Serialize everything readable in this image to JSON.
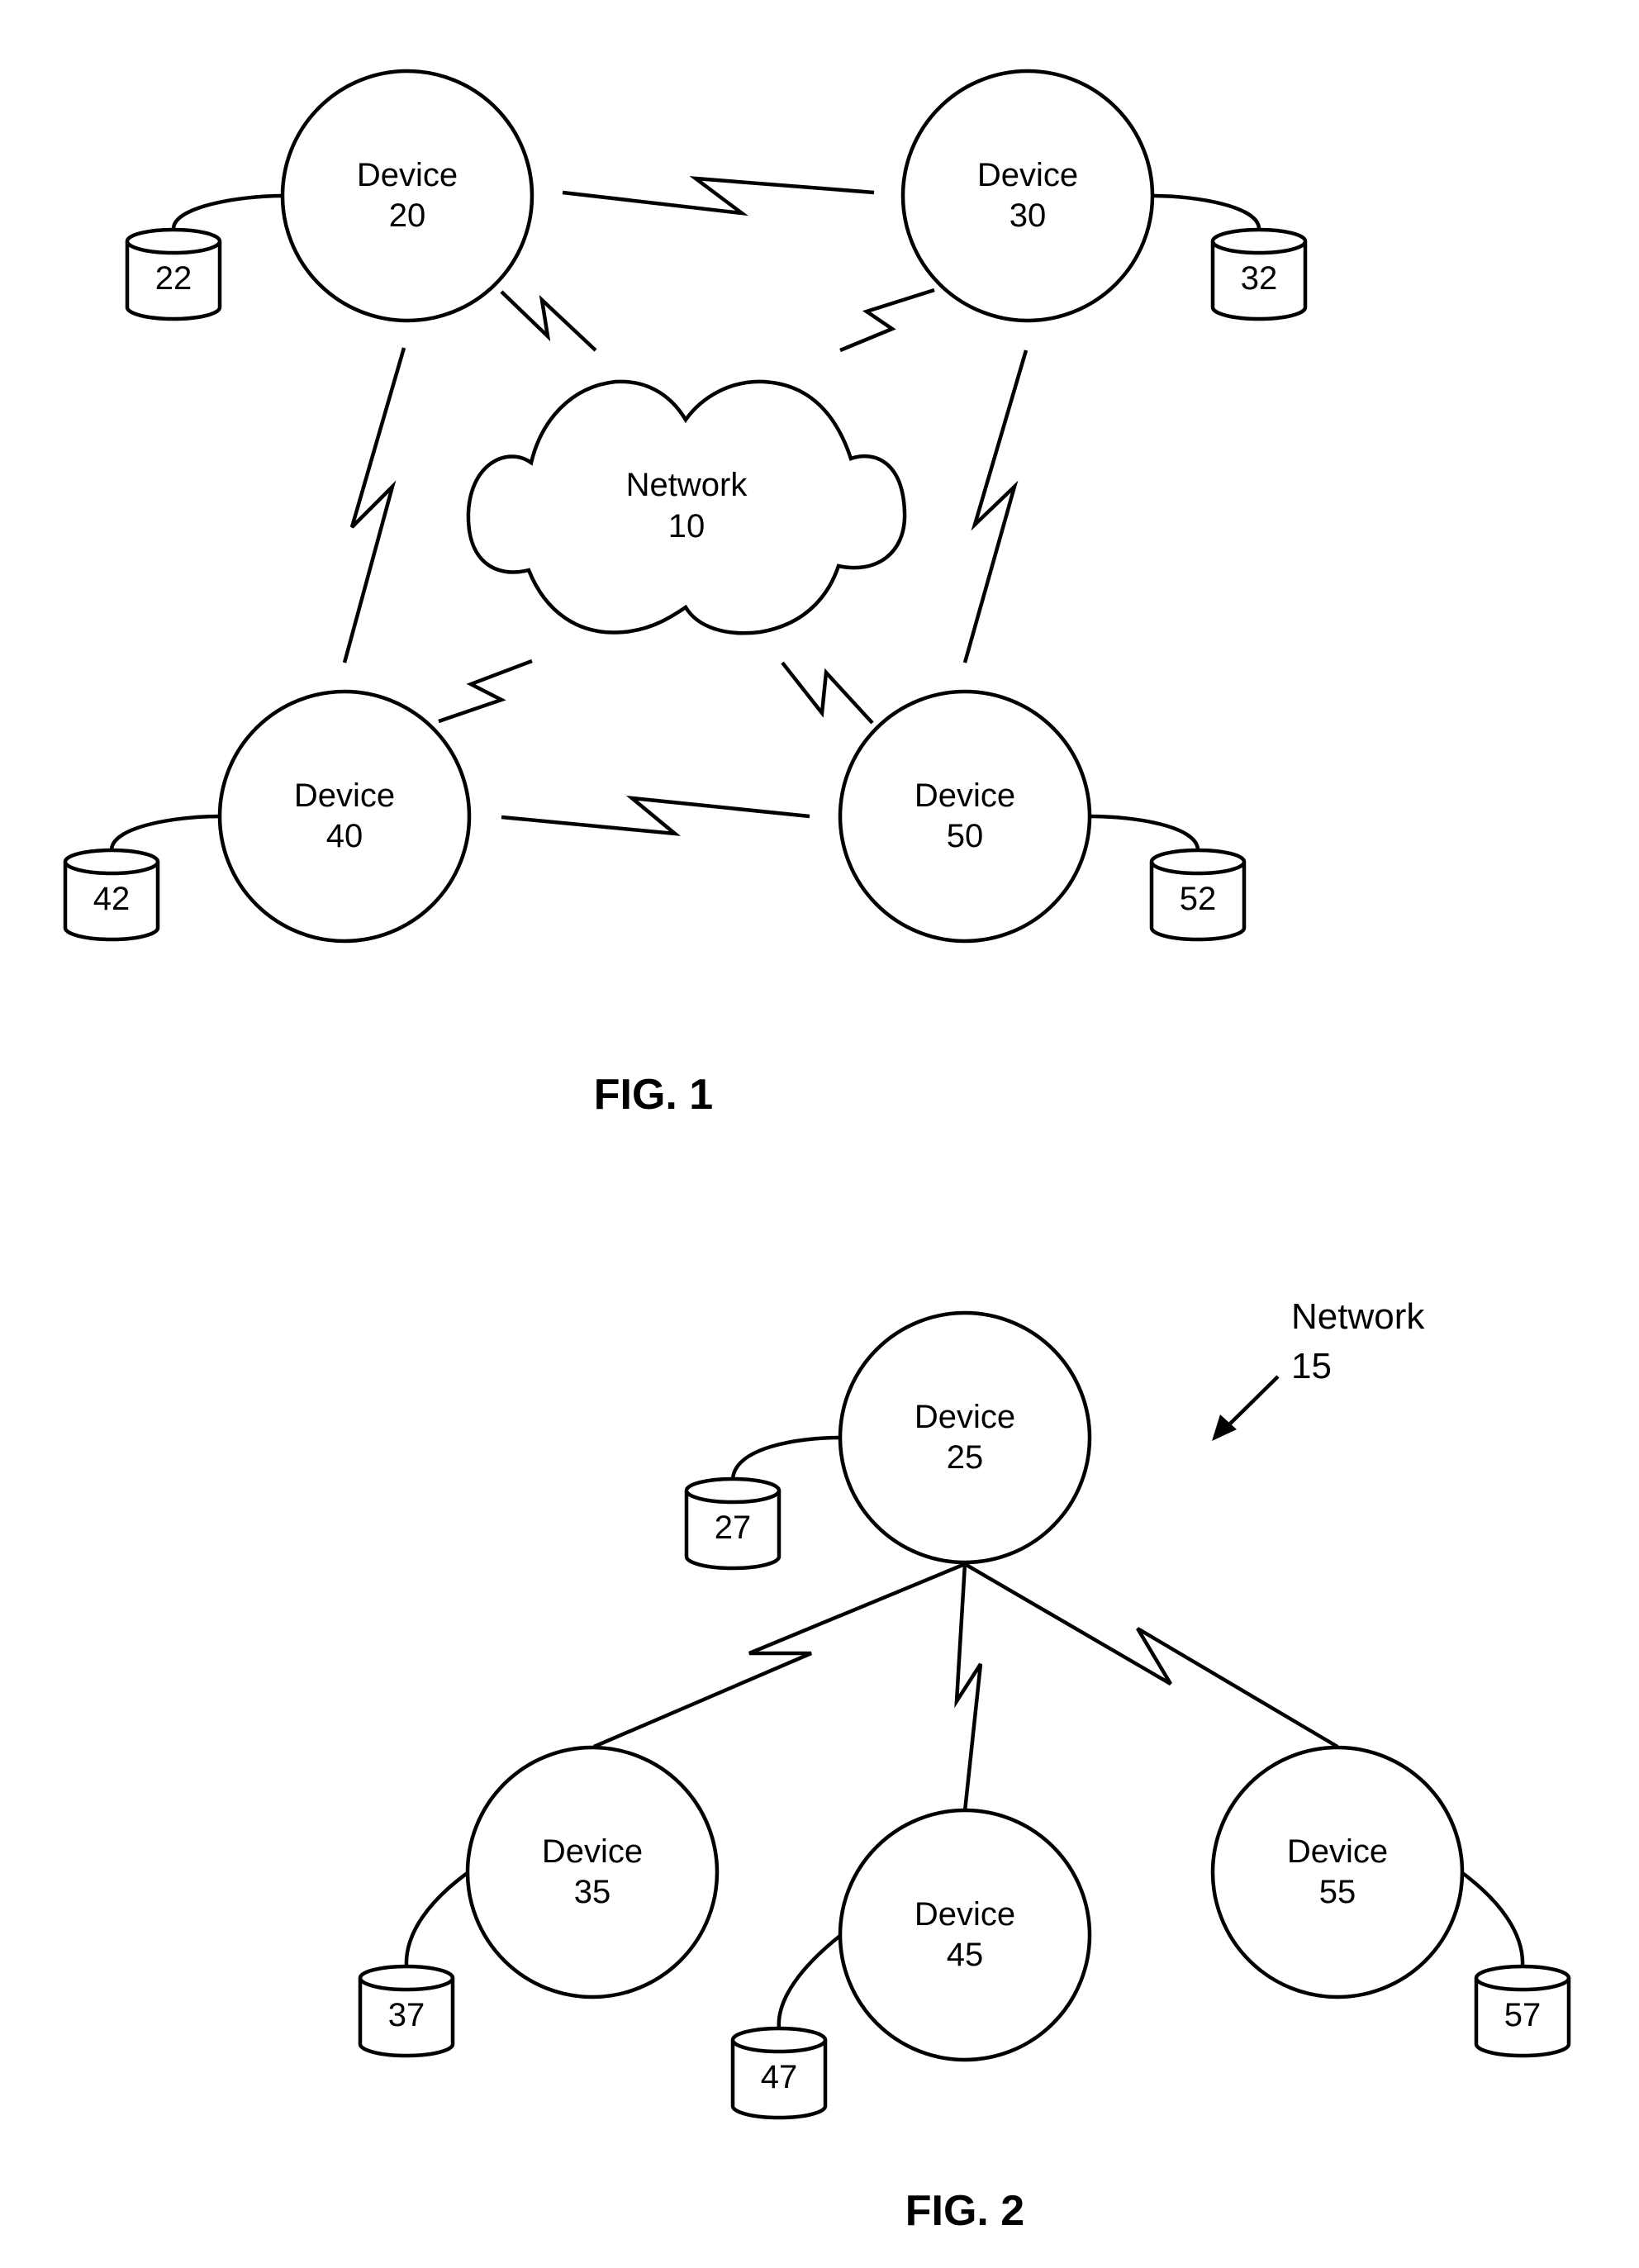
{
  "fig1": {
    "caption": "FIG. 1",
    "network": {
      "label": "Network",
      "number": "10"
    },
    "devices": [
      {
        "id": "20",
        "label": "Device",
        "number": "20",
        "storage": "22"
      },
      {
        "id": "30",
        "label": "Device",
        "number": "30",
        "storage": "32"
      },
      {
        "id": "40",
        "label": "Device",
        "number": "40",
        "storage": "42"
      },
      {
        "id": "50",
        "label": "Device",
        "number": "50",
        "storage": "52"
      }
    ],
    "links": [
      {
        "from": "20",
        "to": "30",
        "type": "wireless"
      },
      {
        "from": "20",
        "to": "40",
        "type": "wireless"
      },
      {
        "from": "30",
        "to": "50",
        "type": "wireless"
      },
      {
        "from": "40",
        "to": "50",
        "type": "wireless"
      },
      {
        "from": "20",
        "to": "network",
        "type": "wireless"
      },
      {
        "from": "30",
        "to": "network",
        "type": "wireless"
      },
      {
        "from": "40",
        "to": "network",
        "type": "wireless"
      },
      {
        "from": "50",
        "to": "network",
        "type": "wireless"
      }
    ]
  },
  "fig2": {
    "caption": "FIG. 2",
    "network_ref": {
      "label": "Network",
      "number": "15"
    },
    "devices": [
      {
        "id": "25",
        "label": "Device",
        "number": "25",
        "storage": "27"
      },
      {
        "id": "35",
        "label": "Device",
        "number": "35",
        "storage": "37"
      },
      {
        "id": "45",
        "label": "Device",
        "number": "45",
        "storage": "47"
      },
      {
        "id": "55",
        "label": "Device",
        "number": "55",
        "storage": "57"
      }
    ],
    "links": [
      {
        "from": "25",
        "to": "35",
        "type": "wireless"
      },
      {
        "from": "25",
        "to": "45",
        "type": "wireless"
      },
      {
        "from": "25",
        "to": "55",
        "type": "wireless"
      }
    ]
  }
}
